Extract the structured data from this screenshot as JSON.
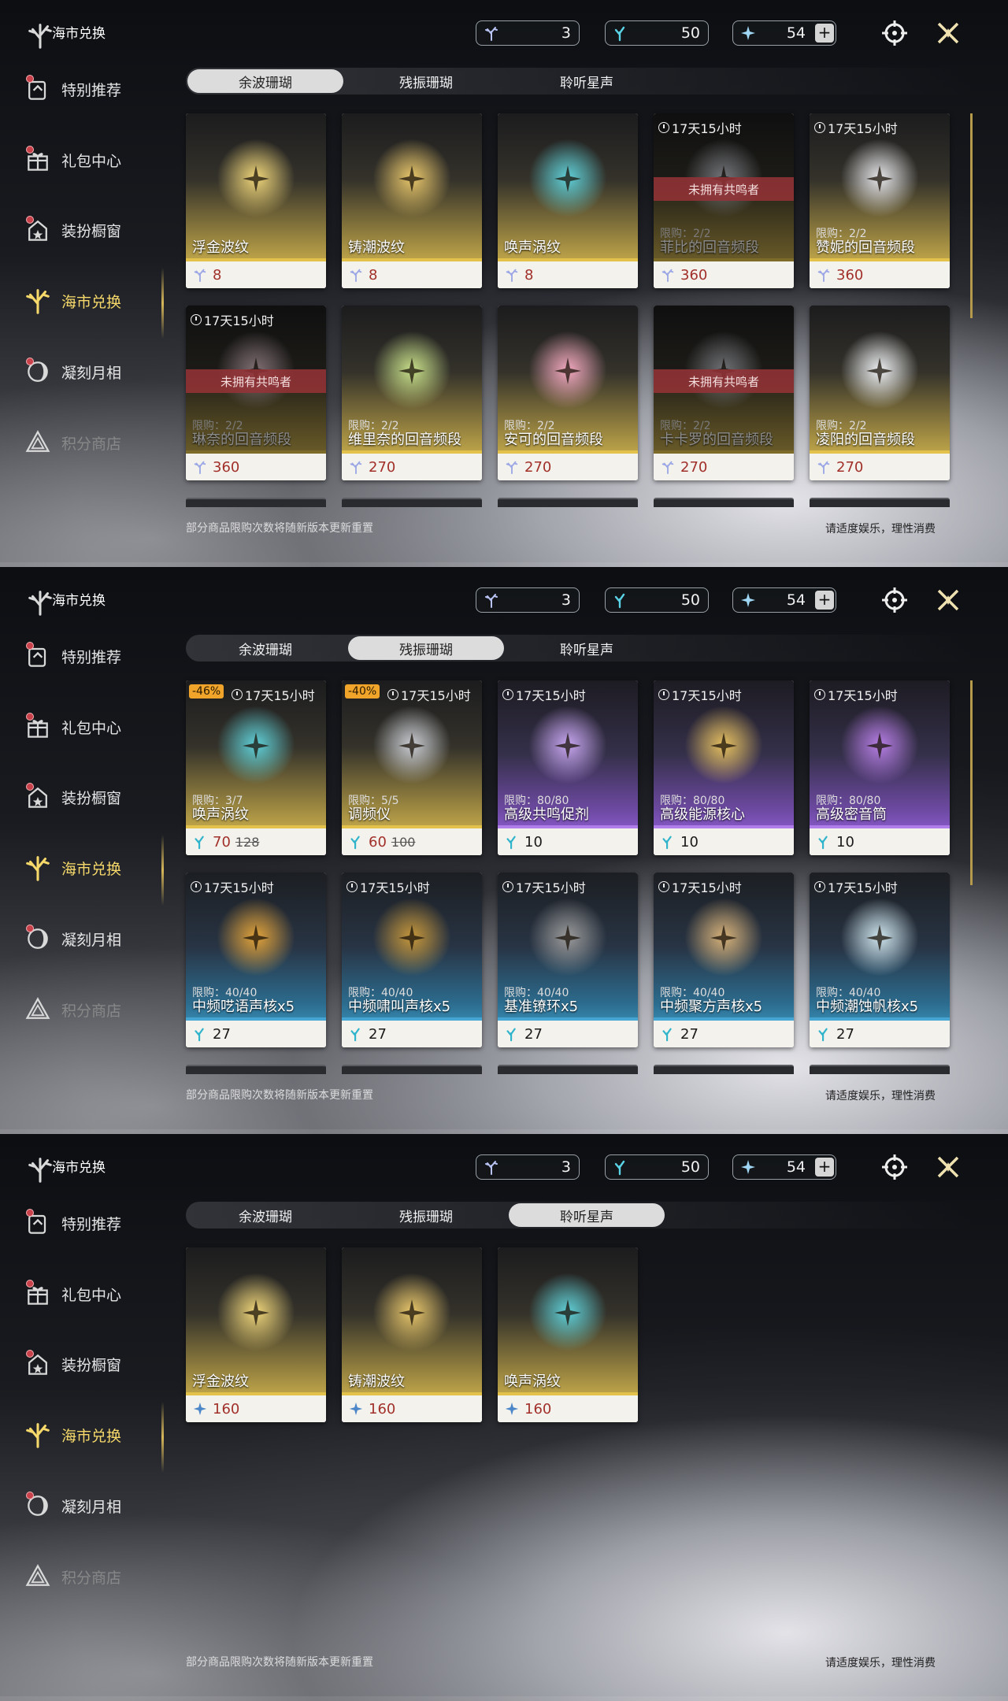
{
  "header": {
    "title": "海市兑换"
  },
  "currencies": [
    {
      "value": "3",
      "icon": "coral-currency-icon",
      "color": "#b9c4f5"
    },
    {
      "value": "50",
      "icon": "echo-coral-icon",
      "color": "#5bd3e6"
    },
    {
      "value": "54",
      "icon": "star-sound-icon",
      "color": "#9fd6f3",
      "has_plus": true
    }
  ],
  "sidebar": [
    {
      "label": "特别推荐",
      "icon": "recommend-icon",
      "dot": true
    },
    {
      "label": "礼包中心",
      "icon": "gift-icon",
      "dot": true
    },
    {
      "label": "装扮橱窗",
      "icon": "wardrobe-icon",
      "dot": true
    },
    {
      "label": "海市兑换",
      "icon": "coral-exchange-icon",
      "active": true
    },
    {
      "label": "凝刻月相",
      "icon": "moon-phase-icon",
      "dot": true
    },
    {
      "label": "积分商店",
      "icon": "points-shop-icon",
      "dim": true
    }
  ],
  "tabs": [
    "余波珊瑚",
    "残振珊瑚",
    "聆听星声"
  ],
  "footer": {
    "notice": "部分商品限购次数将随新版本更新重置",
    "advice": "请适度娱乐，理性消费"
  },
  "screens": [
    {
      "active_tab": 0,
      "cards": [
        {
          "name": "浮金波纹",
          "price": "8",
          "style": "gold",
          "art_color": "#f0d67a"
        },
        {
          "name": "铸潮波纹",
          "price": "8",
          "style": "gold",
          "art_color": "#e9c76b"
        },
        {
          "name": "唤声涡纹",
          "price": "8",
          "style": "gold",
          "art_color": "#5fd0d8"
        },
        {
          "name": "菲比的回音频段",
          "price": "360",
          "style": "gold",
          "timer": "17天15小时",
          "limit": "限购：2/2",
          "badge": "未拥有共鸣者",
          "locked": true,
          "art_color": "#cfd3dc"
        },
        {
          "name": "赞妮的回音频段",
          "price": "360",
          "style": "gold",
          "timer": "17天15小时",
          "limit": "限购：2/2",
          "art_color": "#e6e6ea"
        },
        {
          "name": "琳奈的回音频段",
          "price": "360",
          "style": "gold",
          "timer": "17天15小时",
          "limit": "限购：2/2",
          "badge": "未拥有共鸣者",
          "locked": true,
          "art_color": "#e8c9d2"
        },
        {
          "name": "维里奈的回音频段",
          "price": "270",
          "style": "gold",
          "limit": "限购：2/2",
          "art_color": "#c8e08a"
        },
        {
          "name": "安可的回音频段",
          "price": "270",
          "style": "gold",
          "limit": "限购：2/2",
          "art_color": "#f3a9c0"
        },
        {
          "name": "卡卡罗的回音频段",
          "price": "270",
          "style": "gold",
          "limit": "限购：2/2",
          "badge": "未拥有共鸣者",
          "locked": true,
          "art_color": "#c9ccd4"
        },
        {
          "name": "凌阳的回音频段",
          "price": "270",
          "style": "gold",
          "limit": "限购：2/2",
          "art_color": "#eef0f3"
        }
      ]
    },
    {
      "active_tab": 1,
      "cards": [
        {
          "name": "唤声涡纹",
          "price": "70",
          "old_price": "128",
          "discount": "-46%",
          "style": "gold",
          "timer": "17天15小时",
          "limit": "限购：3/7",
          "art_color": "#5fd0d8"
        },
        {
          "name": "调频仪",
          "price": "60",
          "old_price": "100",
          "discount": "-40%",
          "style": "gold",
          "timer": "17天15小时",
          "limit": "限购：5/5",
          "art_color": "#c9ccd2"
        },
        {
          "name": "高级共鸣促剂",
          "price": "10",
          "style": "purple",
          "timer": "17天15小时",
          "limit": "限购：80/80",
          "art_color": "#c7a6f0"
        },
        {
          "name": "高级能源核心",
          "price": "10",
          "style": "purple",
          "timer": "17天15小时",
          "limit": "限购：80/80",
          "art_color": "#e6c060"
        },
        {
          "name": "高级密音筒",
          "price": "10",
          "style": "purple",
          "timer": "17天15小时",
          "limit": "限购：80/80",
          "art_color": "#b77ee6"
        },
        {
          "name": "中频呓语声核x5",
          "price": "27",
          "style": "blue",
          "timer": "17天15小时",
          "limit": "限购：40/40",
          "art_color": "#e2a33a"
        },
        {
          "name": "中频啸叫声核x5",
          "price": "27",
          "style": "blue",
          "timer": "17天15小时",
          "limit": "限购：40/40",
          "art_color": "#c6973b"
        },
        {
          "name": "基准镣环x5",
          "price": "27",
          "style": "blue",
          "timer": "17天15小时",
          "limit": "限购：40/40",
          "art_color": "#9a9a9a"
        },
        {
          "name": "中频聚方声核x5",
          "price": "27",
          "style": "blue",
          "timer": "17天15小时",
          "limit": "限购：40/40",
          "art_color": "#d7b27a"
        },
        {
          "name": "中频潮蚀帆核x5",
          "price": "27",
          "style": "blue",
          "timer": "17天15小时",
          "limit": "限购：40/40",
          "art_color": "#cfe6ee"
        }
      ]
    },
    {
      "active_tab": 2,
      "cards": [
        {
          "name": "浮金波纹",
          "price": "160",
          "style": "gold",
          "art_color": "#f0d67a"
        },
        {
          "name": "铸潮波纹",
          "price": "160",
          "style": "gold",
          "art_color": "#e9c76b"
        },
        {
          "name": "唤声涡纹",
          "price": "160",
          "style": "gold",
          "art_color": "#5fd0d8"
        }
      ]
    }
  ]
}
